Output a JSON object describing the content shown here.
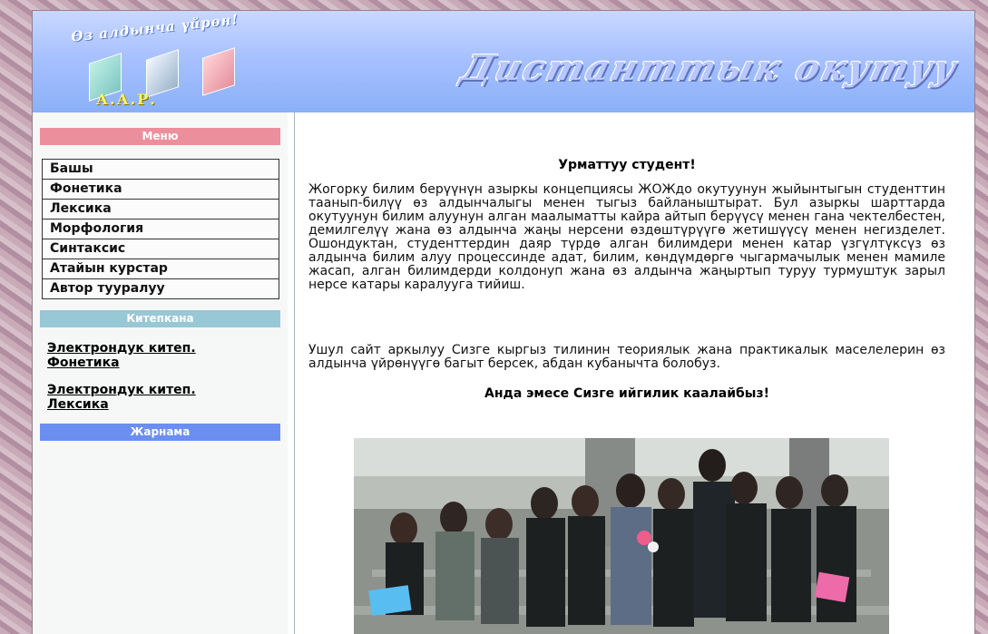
{
  "header": {
    "slogan": "Өз алдынча үйрөн!",
    "initials": "А.А.Р.",
    "title": "Дистанттык окутуу"
  },
  "sidebar": {
    "menu_title": "Меню",
    "menu_items": [
      {
        "label": "Башы"
      },
      {
        "label": "Фонетика"
      },
      {
        "label": "Лексика"
      },
      {
        "label": "Морфология"
      },
      {
        "label": "Синтаксис"
      },
      {
        "label": "Атайын курстар"
      },
      {
        "label": "Автор тууралуу"
      }
    ],
    "library_title": "Китепкана",
    "book_links": [
      {
        "label": "Электрондук китеп. Фонетика"
      },
      {
        "label": "Электрондук китеп. Лексика"
      }
    ],
    "ads_title": "Жарнама"
  },
  "main": {
    "greeting": "Урматтуу студент!",
    "paragraph_1": "Жогорку билим берүүнүн азыркы концепциясы ЖОЖдо окутуунун жыйынтыгын студенттин таанып-билүү өз алдынчалыгы менен тыгыз байланыштырат. Бул азыркы шарттарда окутуунун билим алуунун алган маалыматты кайра айтып берүүсү менен гана чектелбестен, демилгелүү жана өз алдынча жаңы нерсени өздөштүрүүгө жетишүүсү менен негизделет. Ошондуктан, студенттердин даяр түрдө алган билимдери менен катар үзгүлтүксүз өз алдынча билим алуу процессинде адат, билим, көндүмдөргө чыгармачылык менен мамиле жасап, алган билимдерди колдонуп жана өз алдынча жаңыртып туруу турмуштук зарыл нерсе катары каралууга тийиш.",
    "paragraph_2": "Ушул сайт аркылуу Сизге кыргыз тилинин теориялык жана практикалык маселелерин өз алдынча үйрөнүүгө багыт берсек, абдан кубанычта болобуз.",
    "wish": "Анда эмесе Сизге ийгилик каалайбыз!"
  },
  "colors": {
    "header_blue": "#9dbaf8",
    "menu_pink": "#ec8f9c",
    "library_teal": "#98c7d5",
    "ads_blue": "#6b8ff0",
    "sidebar_bg": "#f6f7f7"
  },
  "icons": [
    "book-icon",
    "book-icon",
    "book-icon"
  ]
}
